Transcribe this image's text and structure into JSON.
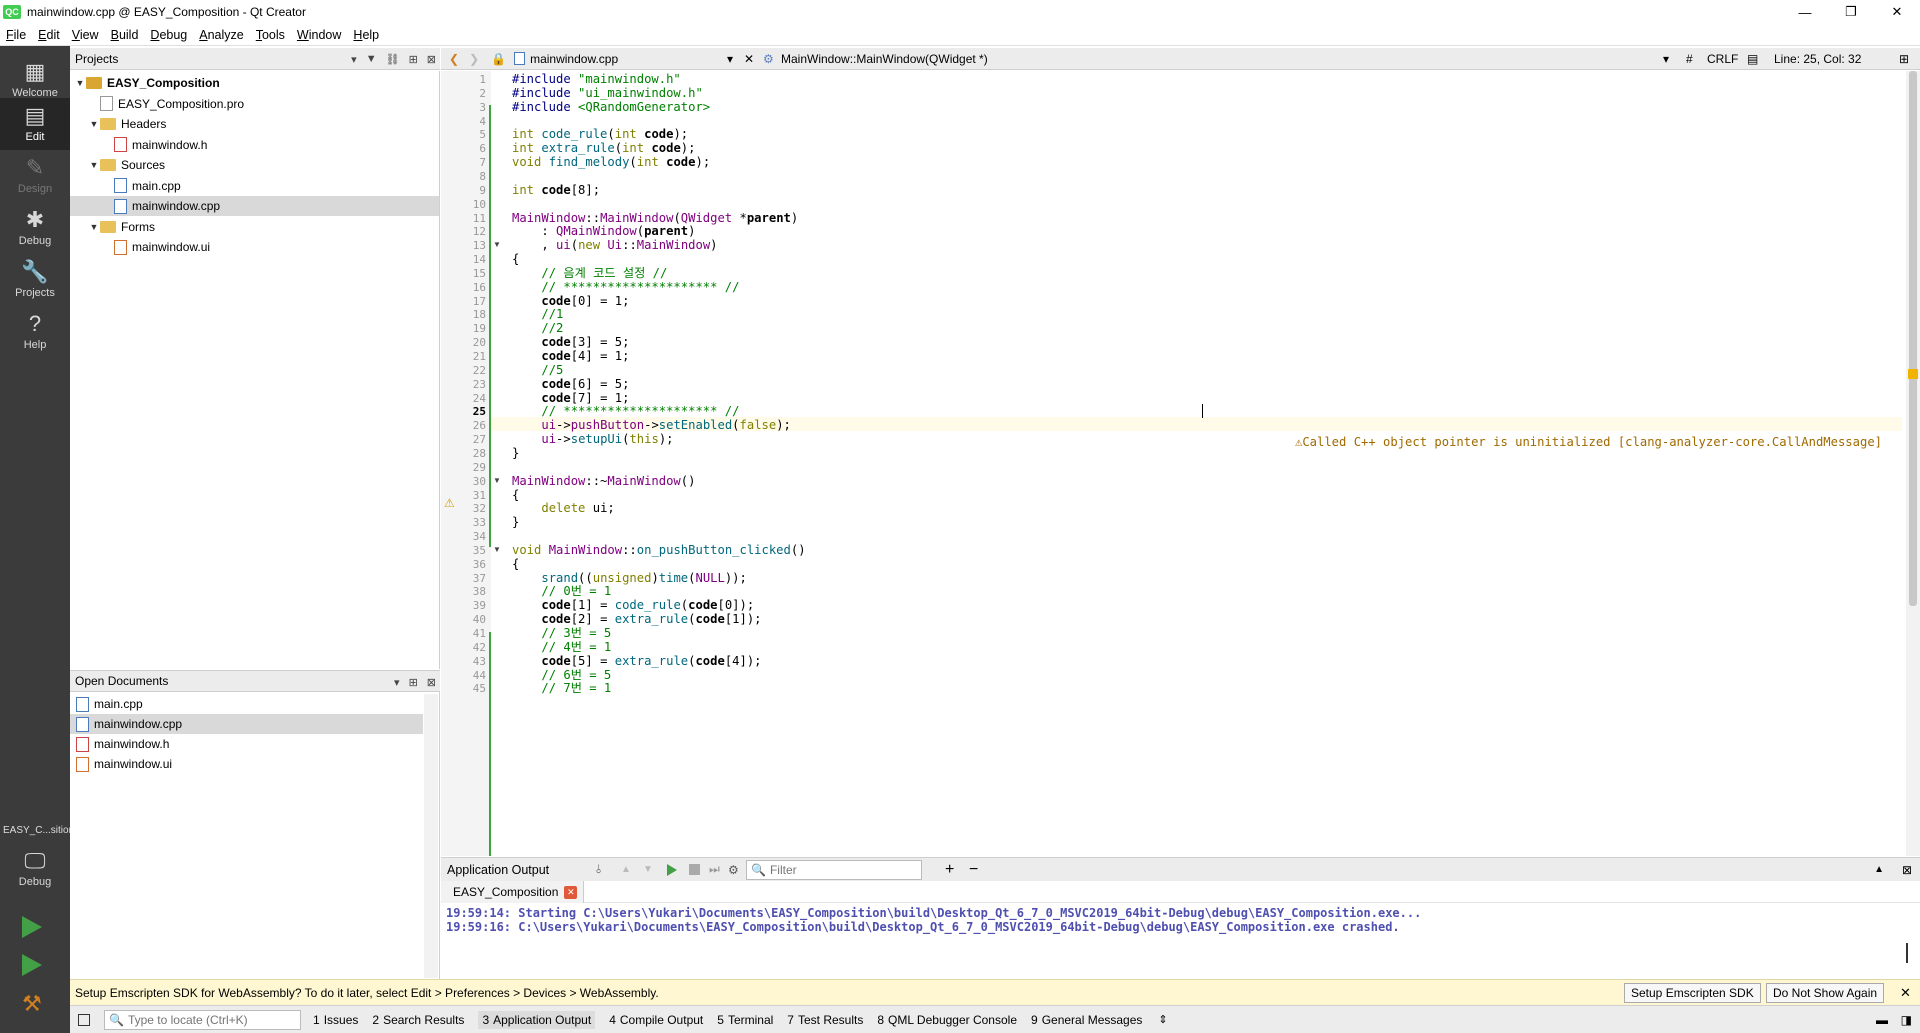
{
  "window": {
    "title": "mainwindow.cpp @ EASY_Composition - Qt Creator",
    "logo": "QC",
    "minimize": "—",
    "restore": "❐",
    "close": "✕"
  },
  "menu": [
    "File",
    "Edit",
    "View",
    "Build",
    "Debug",
    "Analyze",
    "Tools",
    "Window",
    "Help"
  ],
  "modes": {
    "welcome": "Welcome",
    "edit": "Edit",
    "design": "Design",
    "debug": "Debug",
    "projects": "Projects",
    "help": "Help",
    "kit_name": "EASY_C...sition",
    "kit_mode": "Debug"
  },
  "projects": {
    "header": "Projects",
    "tree": [
      {
        "label": "EASY_Composition",
        "kind": "project",
        "depth": 0,
        "bold": true
      },
      {
        "label": "EASY_Composition.pro",
        "kind": "pro",
        "depth": 1
      },
      {
        "label": "Headers",
        "kind": "folder",
        "depth": 1
      },
      {
        "label": "mainwindow.h",
        "kind": "h",
        "depth": 2
      },
      {
        "label": "Sources",
        "kind": "folder",
        "depth": 1
      },
      {
        "label": "main.cpp",
        "kind": "cpp",
        "depth": 2
      },
      {
        "label": "mainwindow.cpp",
        "kind": "cpp",
        "depth": 2,
        "selected": true
      },
      {
        "label": "Forms",
        "kind": "folder",
        "depth": 1
      },
      {
        "label": "mainwindow.ui",
        "kind": "ui",
        "depth": 2
      }
    ]
  },
  "open_documents": {
    "header": "Open Documents",
    "items": [
      {
        "label": "main.cpp",
        "kind": "cpp"
      },
      {
        "label": "mainwindow.cpp",
        "kind": "cpp",
        "selected": true
      },
      {
        "label": "mainwindow.h",
        "kind": "h"
      },
      {
        "label": "mainwindow.ui",
        "kind": "ui"
      }
    ]
  },
  "editor_toolbar": {
    "file": "mainwindow.cpp",
    "symbol": "MainWindow::MainWindow(QWidget *)",
    "hash": "#",
    "line_ending": "CRLF",
    "position": "Line: 25, Col: 32"
  },
  "editor": {
    "current_line": 25,
    "warning_line": 26,
    "warning": "Called C++ object pointer is uninitialized [clang-analyzer-core.CallAndMessage]",
    "line_numbers": [
      "1",
      "2",
      "3",
      "4",
      "5",
      "6",
      "7",
      "8",
      "9",
      "10",
      "11",
      "12",
      "13",
      "14",
      "15",
      "16",
      "17",
      "18",
      "19",
      "20",
      "21",
      "22",
      "23",
      "24",
      "25",
      "26",
      "27",
      "28",
      "29",
      "30",
      "31",
      "32",
      "33",
      "34",
      "35",
      "36",
      "37",
      "38",
      "39",
      "40",
      "41",
      "42",
      "43",
      "44",
      "45"
    ],
    "lines": [
      "#include \"mainwindow.h\"",
      "#include \"ui_mainwindow.h\"",
      "#include <QRandomGenerator>",
      "",
      "int code_rule(int code);",
      "int extra_rule(int code);",
      "void find_melody(int code);",
      "",
      "int code[8];",
      "",
      "MainWindow::MainWindow(QWidget *parent)",
      "    : QMainWindow(parent)",
      "    , ui(new Ui::MainWindow)",
      "{",
      "    // 음계 코드 설정 //",
      "    // ********************* //",
      "    code[0] = 1;",
      "    //1",
      "    //2",
      "    code[3] = 5;",
      "    code[4] = 1;",
      "    //5",
      "    code[6] = 5;",
      "    code[7] = 1;",
      "    // ********************* //",
      "    ui->pushButton->setEnabled(false);",
      "    ui->setupUi(this);",
      "}",
      "",
      "MainWindow::~MainWindow()",
      "{",
      "    delete ui;",
      "}",
      "",
      "void MainWindow::on_pushButton_clicked()",
      "{",
      "    srand((unsigned)time(NULL));",
      "    // 0번 = 1",
      "    code[1] = code_rule(code[0]);",
      "    code[2] = extra_rule(code[1]);",
      "    // 3번 = 5",
      "    // 4번 = 1",
      "    code[5] = extra_rule(code[4]);",
      "    // 6번 = 5",
      "    // 7번 = 1"
    ]
  },
  "output": {
    "header": "Application Output",
    "filter_placeholder": "Filter",
    "tab": "EASY_Composition",
    "lines": [
      "19:59:14: Starting C:\\Users\\Yukari\\Documents\\EASY_Composition\\build\\Desktop_Qt_6_7_0_MSVC2019_64bit-Debug\\debug\\EASY_Composition.exe...",
      "19:59:16: C:\\Users\\Yukari\\Documents\\EASY_Composition\\build\\Desktop_Qt_6_7_0_MSVC2019_64bit-Debug\\debug\\EASY_Composition.exe crashed."
    ]
  },
  "infobar": {
    "message": "Setup Emscripten SDK for WebAssembly? To do it later, select Edit > Preferences > Devices > WebAssembly.",
    "setup_button": "Setup Emscripten SDK",
    "dismiss_button": "Do Not Show Again"
  },
  "statusbar": {
    "locate_placeholder": "Type to locate (Ctrl+K)",
    "tabs": [
      {
        "n": "1",
        "label": "Issues"
      },
      {
        "n": "2",
        "label": "Search Results"
      },
      {
        "n": "3",
        "label": "Application Output",
        "active": true
      },
      {
        "n": "4",
        "label": "Compile Output"
      },
      {
        "n": "5",
        "label": "Terminal"
      },
      {
        "n": "7",
        "label": "Test Results"
      },
      {
        "n": "8",
        "label": "QML Debugger Console"
      },
      {
        "n": "9",
        "label": "General Messages"
      }
    ]
  },
  "colors": {
    "mode_bar": "#3b3b3b",
    "keyword": "#808000",
    "type": "#800080",
    "string": "#008000",
    "output_text": "#4f4fb0",
    "warning_bg": "#fffbe8",
    "run_green": "#43a047"
  }
}
